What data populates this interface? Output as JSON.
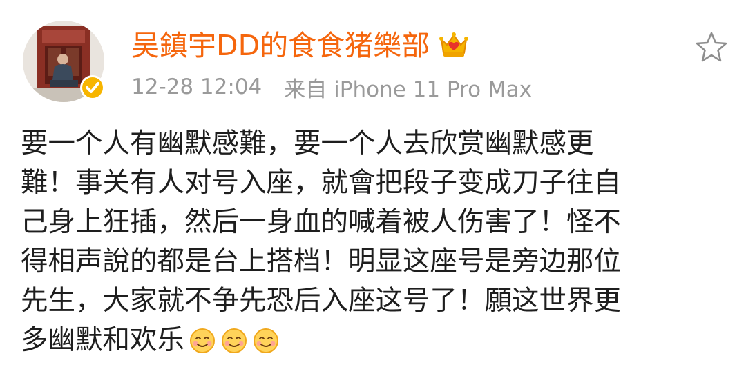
{
  "post": {
    "author": {
      "name": "吴鎮宇DD的食食猪樂部",
      "avatar_icon": "avatar-photo",
      "verified_icon": "verified-badge-icon",
      "membership_icon": "crown-icon",
      "name_color": "#f5660d"
    },
    "timestamp": "12-28 12:04",
    "source": "来自 iPhone 11 Pro Max",
    "favorite_icon": "star-outline-icon",
    "text_lines": [
      "要一个人有幽默感難，要一个人去欣赏幽默感更",
      "難！事关有人对号入座，就會把段子变成刀子往自",
      "己身上狂插，然后一身血的喊着被人伤害了！怪不",
      "得相声說的都是台上搭档！明显这座号是旁边那位",
      "先生，大家就不争先恐后入座这号了！願这世界更",
      "多幽默和欢乐"
    ],
    "emoji": [
      "smile-emoji-icon",
      "smile-emoji-icon",
      "smile-emoji-icon"
    ]
  }
}
